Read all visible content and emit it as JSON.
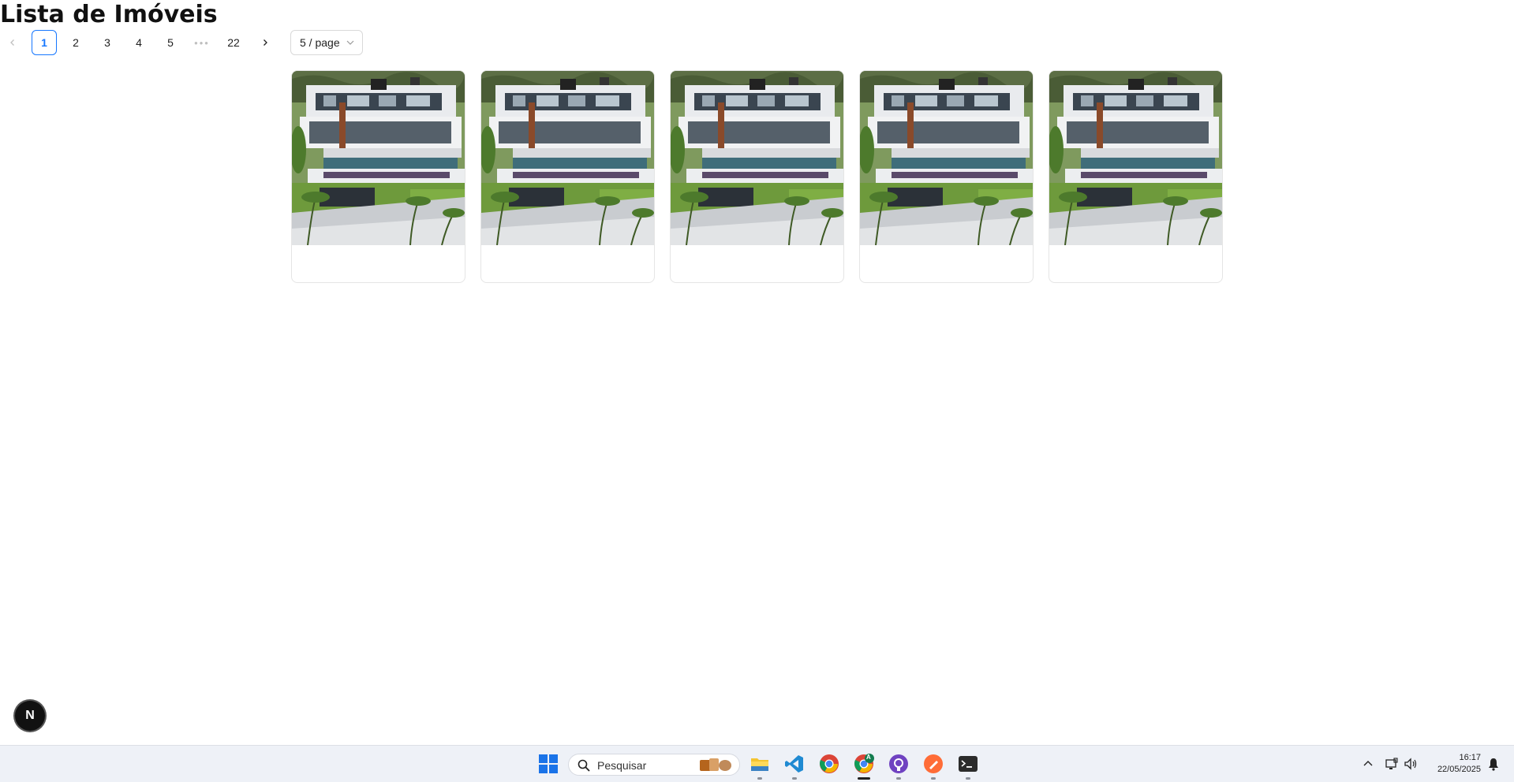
{
  "page": {
    "title": "Lista de Imóveis"
  },
  "pagination": {
    "prev_icon": "chevron-left-icon",
    "next_icon": "chevron-right-icon",
    "pages": [
      "1",
      "2",
      "3",
      "4",
      "5"
    ],
    "current_page": "1",
    "ellipsis": "•••",
    "last_page": "22",
    "page_size": "5 / page",
    "accent_color": "#1677ff"
  },
  "cards": [
    {
      "image": "luxury-villa-photo"
    },
    {
      "image": "luxury-villa-photo"
    },
    {
      "image": "luxury-villa-photo"
    },
    {
      "image": "luxury-villa-photo"
    },
    {
      "image": "luxury-villa-photo"
    }
  ],
  "dev_badge": {
    "label": "N"
  },
  "taskbar": {
    "search_placeholder": "Pesquisar",
    "apps": [
      "windows-start-icon",
      "file-explorer-icon",
      "vscode-icon",
      "chrome-icon",
      "chrome-profile-icon",
      "github-desktop-icon",
      "postman-icon",
      "terminal-icon"
    ],
    "chrome_profile_badge": "A",
    "clock_time": "16:17",
    "clock_date": "22/05/2025"
  }
}
